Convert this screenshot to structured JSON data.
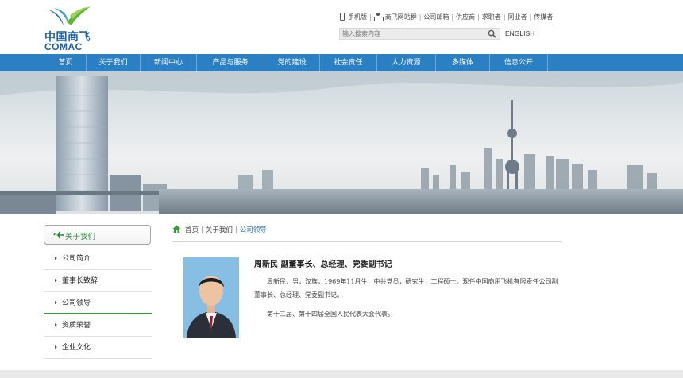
{
  "logo": {
    "cn": "中国商飞",
    "en": "COMAC"
  },
  "toplinks": [
    {
      "label": "手机版",
      "icon": "phone-icon"
    },
    {
      "label": "商飞网站群",
      "icon": "network-icon"
    },
    {
      "label": "公司邮箱"
    },
    {
      "label": "供应商"
    },
    {
      "label": "求职者"
    },
    {
      "label": "同业者"
    },
    {
      "label": "传媒者"
    }
  ],
  "search": {
    "placeholder": "输入搜索内容"
  },
  "english_label": "ENGLISH",
  "nav": [
    "首页",
    "关于我们",
    "新闻中心",
    "产品与服务",
    "党的建设",
    "社会责任",
    "人力资源",
    "多媒体",
    "信息公开"
  ],
  "sidebar": {
    "title": "关于我们",
    "items": [
      "公司简介",
      "董事长致辞",
      "公司领导",
      "资质荣誉",
      "企业文化"
    ],
    "active_index": 2
  },
  "breadcrumb": {
    "home": "首页",
    "section": "关于我们",
    "current": "公司领导"
  },
  "leader": {
    "name_title": "周新民  副董事长、总经理、党委副书记",
    "para1": "周新民，男，汉族，1969年11月生，中共党员，研究生，工程硕士。现任中国商用飞机有限责任公司副董事长、总经理、党委副书记。",
    "para2": "第十三届、第十四届全国人民代表大会代表。"
  },
  "colors": {
    "nav_bg": "#2a80c3",
    "accent_green": "#3a9a3c",
    "link_blue": "#1f6fb5"
  }
}
